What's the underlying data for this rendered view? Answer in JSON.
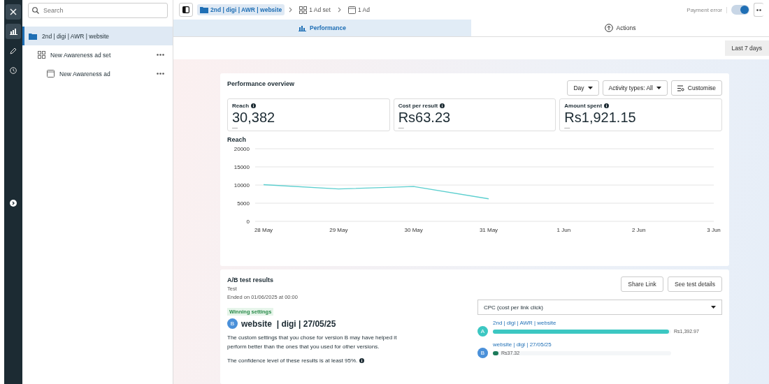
{
  "search": {
    "placeholder": "Search"
  },
  "tree": [
    {
      "label": "2nd | digi | AWR | website",
      "kind": "campaign",
      "selected": true,
      "children": [
        {
          "label": "New Awareness ad set",
          "kind": "adset",
          "selected": false,
          "children": [
            {
              "label": "New Awareness ad",
              "kind": "ad",
              "selected": false
            }
          ]
        }
      ]
    }
  ],
  "breadcrumb": [
    {
      "label": "2nd | digi | AWR | website",
      "kind": "campaign",
      "selected": true
    },
    {
      "label": "1 Ad set",
      "kind": "adset",
      "selected": false
    },
    {
      "label": "1 Ad",
      "kind": "ad",
      "selected": false
    }
  ],
  "status": {
    "label": "Payment error",
    "on": true
  },
  "tabs": [
    {
      "label": "Performance",
      "kind": "chart",
      "selected": true
    },
    {
      "label": "Actions",
      "kind": "upload",
      "selected": false
    }
  ],
  "date_range": "Last 7 days",
  "overview": {
    "title": "Performance overview",
    "controls": [
      {
        "label": "Day",
        "kind": "dropdown"
      },
      {
        "label": "Activity types: All",
        "kind": "dropdown"
      },
      {
        "label": "Customise",
        "kind": "customise"
      }
    ],
    "metrics": [
      {
        "label": "Reach",
        "value": "30,382",
        "change": "—"
      },
      {
        "label": "Cost per result",
        "value": "Rs63.23",
        "change": "—"
      },
      {
        "label": "Amount spent",
        "value": "Rs1,921.15",
        "change": "—"
      }
    ],
    "chart_data": {
      "type": "line",
      "title": "Reach",
      "categories": [
        "28 May",
        "29 May",
        "30 May",
        "31 May",
        "1 Jun",
        "2 Jun",
        "3 Jun"
      ],
      "series": [
        {
          "color": "#5ccfcf",
          "values": [
            10100,
            8900,
            9600,
            6200,
            null,
            null,
            null
          ]
        }
      ],
      "ylim": [
        0,
        20000
      ],
      "yticks": [
        0,
        5000,
        10000,
        15000,
        20000
      ],
      "grid": true
    }
  },
  "ab_test": {
    "title": "A/B test results",
    "subtitle": "Test",
    "ended": "Ended on 01/06/2025 at 00:00",
    "buttons": [
      "Share Link",
      "See test details"
    ],
    "badge": "Winning settings",
    "winner_letter": "B",
    "winner_name": "website  | digi | 27/05/25",
    "description": "The custom settings that you chose for version B may have helped it perform better than the ones that you used for other versions.",
    "confidence": "The confidence level of these results is at least 95%.",
    "metric_select": "CPC (cost per link click)",
    "versions": [
      {
        "letter": "A",
        "name": "2nd | digi | AWR | website",
        "value": "Rs1,392.97",
        "level": 0.99,
        "color": "#3cc7c2"
      },
      {
        "letter": "B",
        "name": "website | digi | 27/05/25",
        "value": "Rs37.32",
        "level": 0.03,
        "color": "#1c7a5a"
      }
    ]
  }
}
